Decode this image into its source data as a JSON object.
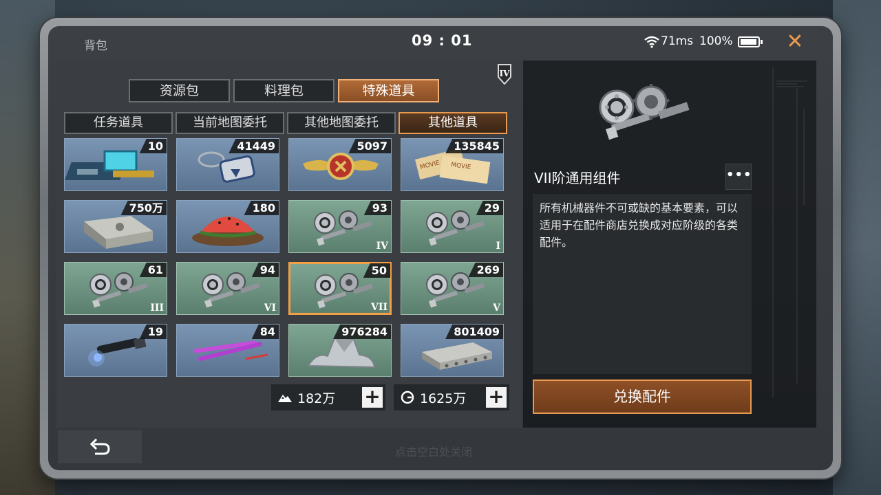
{
  "header": {
    "title": "背包",
    "clock": "09 : 01",
    "ping": "71ms",
    "battery": "100%",
    "close_icon": "close-x"
  },
  "tier_badge": "IV",
  "tabs_primary": [
    {
      "label": "资源包",
      "active": false
    },
    {
      "label": "料理包",
      "active": false
    },
    {
      "label": "特殊道具",
      "active": true
    }
  ],
  "tabs_secondary": [
    {
      "label": "任务道具",
      "active": false
    },
    {
      "label": "当前地图委托",
      "active": false
    },
    {
      "label": "其他地图委托",
      "active": false
    },
    {
      "label": "其他道具",
      "active": true
    }
  ],
  "items": [
    {
      "count": "10",
      "grade": "",
      "icon": "chip-card",
      "theme": "blue"
    },
    {
      "count": "41449",
      "grade": "",
      "icon": "dog-tag",
      "theme": "blue"
    },
    {
      "count": "5097",
      "grade": "",
      "icon": "winged-medal",
      "theme": "blue"
    },
    {
      "count": "135845",
      "grade": "",
      "icon": "movie-tickets",
      "theme": "blue"
    },
    {
      "count": "750万",
      "grade": "",
      "icon": "cash-stack",
      "theme": "blue"
    },
    {
      "count": "180",
      "grade": "",
      "icon": "watermelon",
      "theme": "blue"
    },
    {
      "count": "93",
      "grade": "IV",
      "icon": "gear-component",
      "theme": "green"
    },
    {
      "count": "29",
      "grade": "I",
      "icon": "gear-component",
      "theme": "green"
    },
    {
      "count": "61",
      "grade": "III",
      "icon": "gear-component",
      "theme": "green"
    },
    {
      "count": "94",
      "grade": "VI",
      "icon": "gear-component",
      "theme": "green"
    },
    {
      "count": "50",
      "grade": "VII",
      "icon": "gear-component",
      "theme": "green",
      "selected": true
    },
    {
      "count": "269",
      "grade": "V",
      "icon": "gear-component",
      "theme": "green"
    },
    {
      "count": "19",
      "grade": "",
      "icon": "flashlight",
      "theme": "blue"
    },
    {
      "count": "84",
      "grade": "",
      "icon": "glow-sticks",
      "theme": "blue"
    },
    {
      "count": "976284",
      "grade": "",
      "icon": "metal-scrap",
      "theme": "green"
    },
    {
      "count": "801409",
      "grade": "",
      "icon": "concrete-slab",
      "theme": "blue"
    }
  ],
  "currency": [
    {
      "icon": "mountain-icon",
      "value": "182万"
    },
    {
      "icon": "coin-g-icon",
      "value": "1625万"
    }
  ],
  "detail": {
    "name": "VII阶通用组件",
    "more_label": "•••",
    "description": "所有机械器件不可或缺的基本要素，可以适用于在配件商店兑换成对应阶级的各类配件。",
    "action_label": "兑换配件"
  },
  "footer": {
    "hint": "点击空白处关闭",
    "back_icon": "return-arrow"
  }
}
